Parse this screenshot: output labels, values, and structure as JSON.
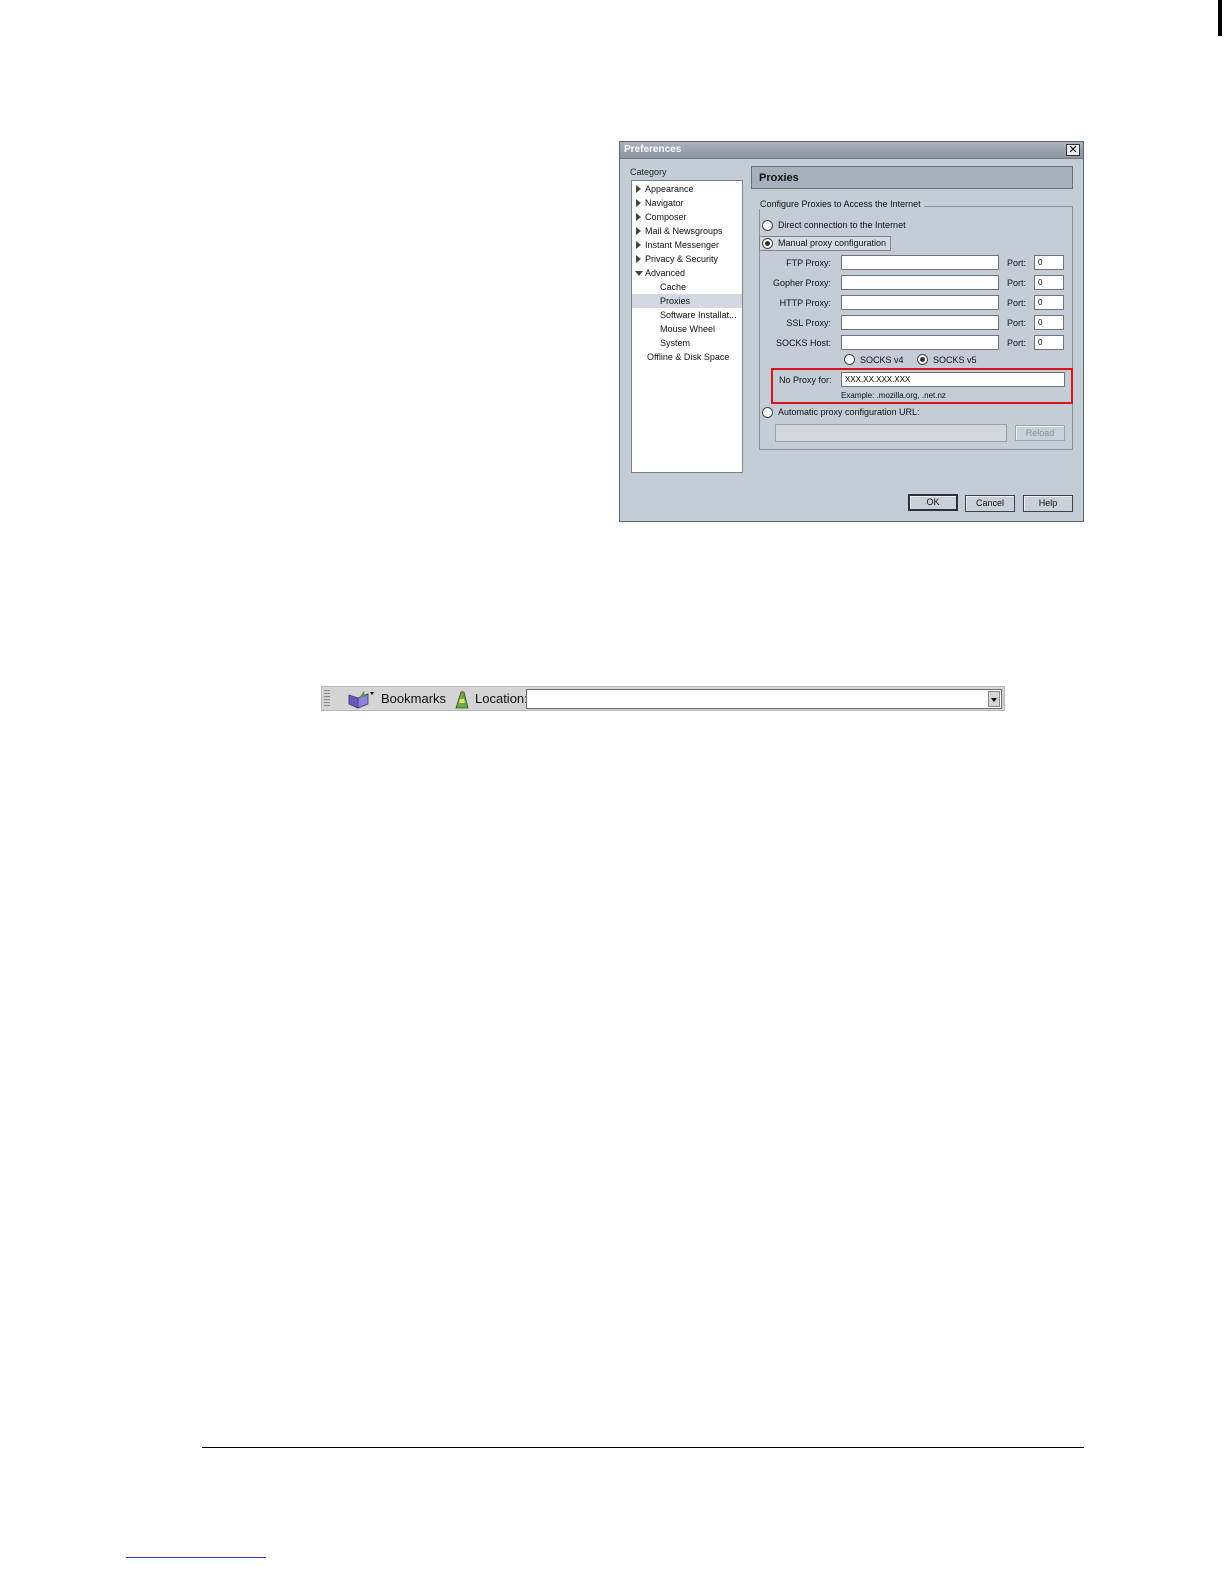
{
  "dialog": {
    "title": "Preferences",
    "close_label": "✕",
    "category_label": "Category",
    "tree": [
      {
        "label": "Appearance",
        "level": 0,
        "twisty": "collapsed"
      },
      {
        "label": "Navigator",
        "level": 0,
        "twisty": "collapsed"
      },
      {
        "label": "Composer",
        "level": 0,
        "twisty": "collapsed"
      },
      {
        "label": "Mail & Newsgroups",
        "level": 0,
        "twisty": "collapsed"
      },
      {
        "label": "Instant Messenger",
        "level": 0,
        "twisty": "collapsed"
      },
      {
        "label": "Privacy & Security",
        "level": 0,
        "twisty": "collapsed"
      },
      {
        "label": "Advanced",
        "level": 0,
        "twisty": "expanded"
      },
      {
        "label": "Cache",
        "level": 1
      },
      {
        "label": "Proxies",
        "level": 1,
        "selected": true
      },
      {
        "label": "Software Installat...",
        "level": 1
      },
      {
        "label": "Mouse Wheel",
        "level": 1
      },
      {
        "label": "System",
        "level": 1
      },
      {
        "label": "Offline & Disk Space",
        "level": 0
      }
    ],
    "panel_title": "Proxies",
    "group_label": "Configure Proxies to Access the Internet",
    "direct_label": "Direct connection to the Internet",
    "manual_label": "Manual proxy configuration",
    "proxies": [
      {
        "label": "FTP Proxy:",
        "value": "",
        "port_label": "Port:",
        "port": "0"
      },
      {
        "label": "Gopher Proxy:",
        "value": "",
        "port_label": "Port:",
        "port": "0"
      },
      {
        "label": "HTTP Proxy:",
        "value": "",
        "port_label": "Port:",
        "port": "0"
      },
      {
        "label": "SSL Proxy:",
        "value": "",
        "port_label": "Port:",
        "port": "0"
      },
      {
        "label": "SOCKS Host:",
        "value": "",
        "port_label": "Port:",
        "port": "0"
      }
    ],
    "socks_v4_label": "SOCKS v4",
    "socks_v5_label": "SOCKS v5",
    "no_proxy_label": "No Proxy for:",
    "no_proxy_value": "XXX.XX.XXX.XXX",
    "example_text": "Example: .mozilla.org, .net.nz",
    "auto_label": "Automatic proxy configuration URL:",
    "auto_url_value": "",
    "reload_label": "Reload",
    "ok_label": "OK",
    "cancel_label": "Cancel",
    "help_label": "Help"
  },
  "toolbar": {
    "bookmarks_label": "Bookmarks",
    "location_label": "Location:",
    "url_value": ""
  },
  "colors": {
    "highlight_border": "#d8141a",
    "dialog_bg": "#c4ccd6"
  }
}
